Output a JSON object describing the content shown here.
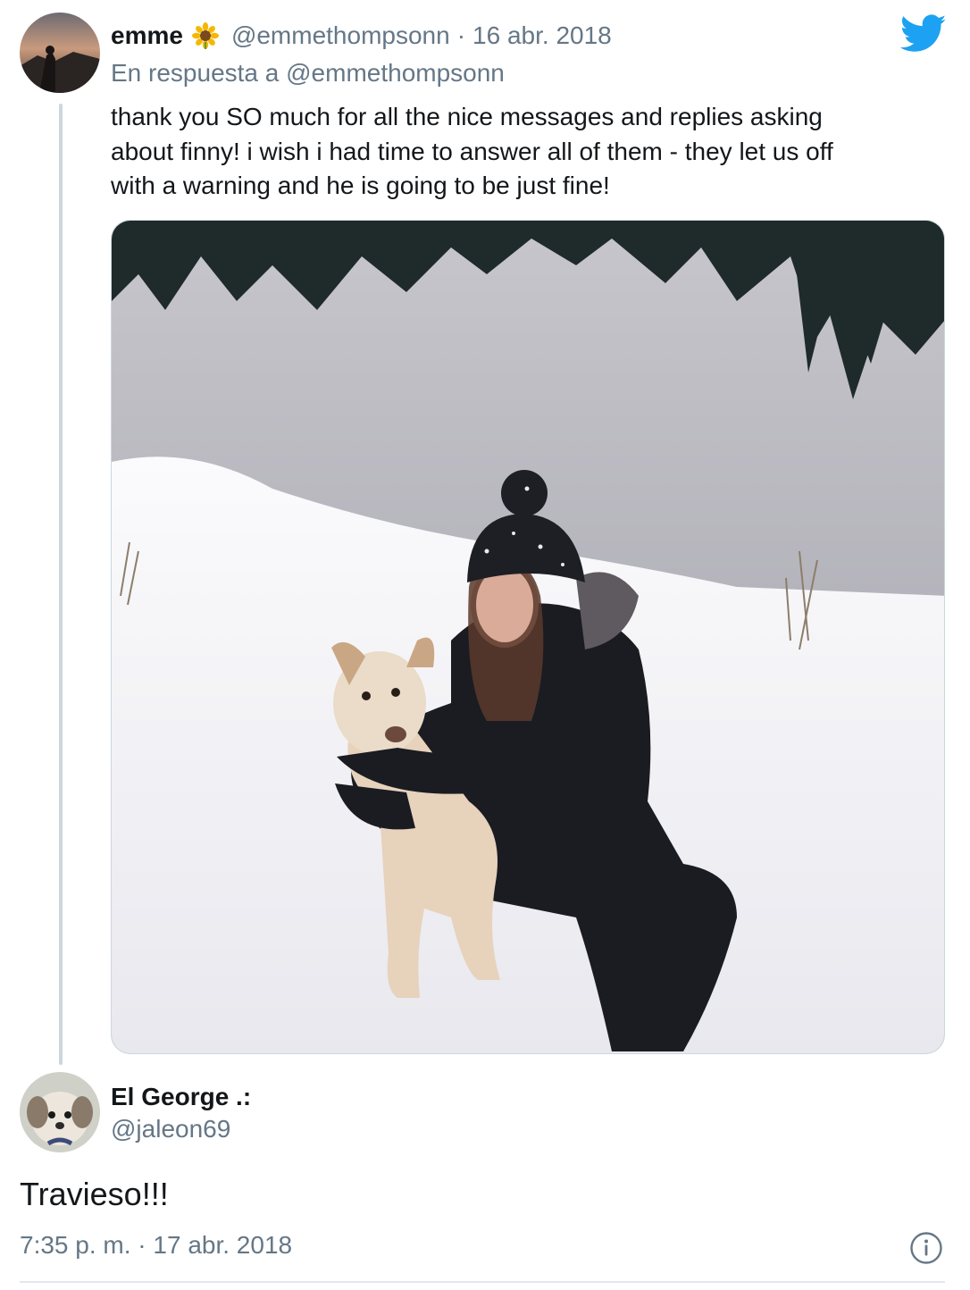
{
  "parent_tweet": {
    "author_name": "emme",
    "author_emoji": "sunflower-icon",
    "handle": "@emmethompsonn",
    "separator": "·",
    "date": "16 abr. 2018",
    "reply_to": "En respuesta a @emmethompsonn",
    "text_lines": [
      "thank you SO much for all the nice messages and replies asking",
      "about finny! i wish i had time to answer all of them - they let us off",
      "with a warning and he is going to be just fine!"
    ]
  },
  "reply_tweet": {
    "author_name": "El George .:",
    "handle": "@jaleon69",
    "text": "Travieso!!!",
    "meta": "7:35 p. m. · 17 abr. 2018"
  },
  "icons": {
    "brand": "twitter-bird-icon",
    "info": "info-icon"
  },
  "colors": {
    "brand_blue": "#1da1f2",
    "secondary_text": "#657786",
    "primary_text": "#14171a",
    "border": "#ccd6dd"
  }
}
